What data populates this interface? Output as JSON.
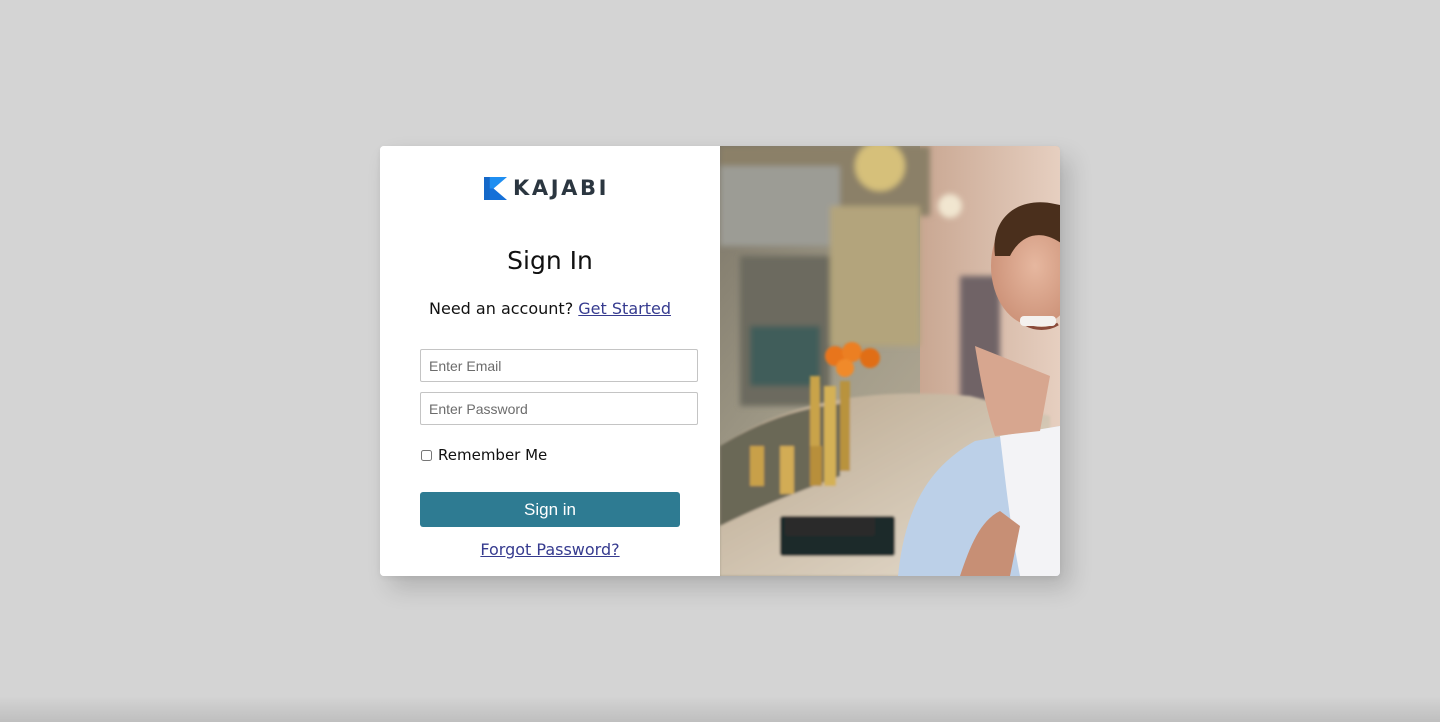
{
  "brand": {
    "name": "KAJABI",
    "accent": "#1f8ef1"
  },
  "signin": {
    "title": "Sign In",
    "account_prompt": "Need an account?",
    "get_started_link": "Get Started",
    "email_placeholder": "Enter Email",
    "password_placeholder": "Enter Password",
    "remember_label": "Remember Me",
    "remember_checked": false,
    "submit_label": "Sign in",
    "forgot_link": "Forgot Password?",
    "button_color": "#2e7b92",
    "link_color": "#363b8f"
  },
  "photo": {
    "description_icon": "restaurant-bar-photo"
  }
}
